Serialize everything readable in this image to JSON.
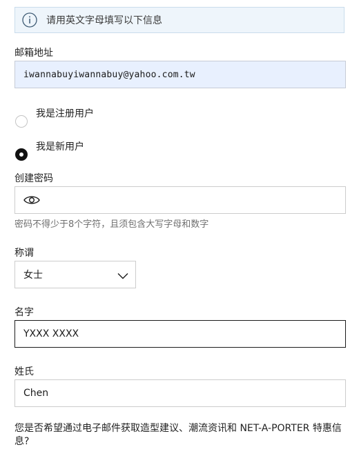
{
  "notice": {
    "icon": "info-icon",
    "text": "请用英文字母填写以下信息"
  },
  "email": {
    "label": "邮箱地址",
    "value": "iwannabuyiwannabuy@yahoo.com.tw",
    "autofill_bg": "#e8f0fe"
  },
  "account_type": {
    "options": [
      {
        "label": "我是注册用户",
        "selected": false
      },
      {
        "label": "我是新用户",
        "selected": true
      }
    ]
  },
  "password": {
    "label": "创建密码",
    "value": "",
    "toggle_icon": "eye-icon",
    "helper": "密码不得少于8个字符，且须包含大写字母和数字"
  },
  "title": {
    "label": "称谓",
    "selected": "女士",
    "icon": "chevron-down-icon"
  },
  "first_name": {
    "label": "名字",
    "value": "YXXX XXXX"
  },
  "last_name": {
    "label": "姓氏",
    "value": "Chen"
  },
  "marketing": {
    "question": "您是否希望通过电子邮件获取造型建议、潮流资讯和 NET-A-PORTER 特惠信息?"
  }
}
